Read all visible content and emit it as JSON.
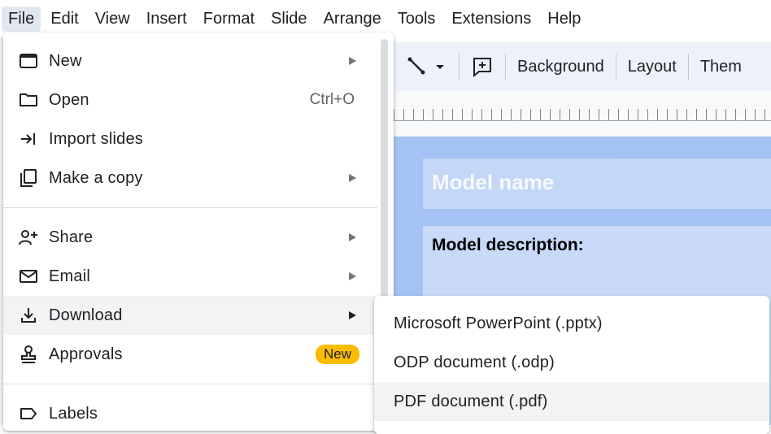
{
  "menubar": {
    "items": [
      "File",
      "Edit",
      "View",
      "Insert",
      "Format",
      "Slide",
      "Arrange",
      "Tools",
      "Extensions",
      "Help"
    ]
  },
  "toolbar": {
    "background_label": "Background",
    "layout_label": "Layout",
    "theme_label": "Them"
  },
  "slide": {
    "title_placeholder": "Model name",
    "description_label": "Model description:"
  },
  "file_menu": {
    "items": [
      {
        "label": "New",
        "icon": "new-presentation-icon",
        "submenu": true
      },
      {
        "label": "Open",
        "icon": "folder-icon",
        "shortcut": "Ctrl+O"
      },
      {
        "label": "Import slides",
        "icon": "import-icon"
      },
      {
        "label": "Make a copy",
        "icon": "copy-icon",
        "submenu": true
      },
      {
        "label": "Share",
        "icon": "share-person-icon",
        "submenu": true
      },
      {
        "label": "Email",
        "icon": "email-icon",
        "submenu": true
      },
      {
        "label": "Download",
        "icon": "download-icon",
        "submenu": true
      },
      {
        "label": "Approvals",
        "icon": "approvals-stamp-icon",
        "badge": "New"
      },
      {
        "label": "Labels",
        "icon": "label-icon"
      }
    ]
  },
  "download_submenu": {
    "items": [
      {
        "label": "Microsoft PowerPoint (.pptx)"
      },
      {
        "label": "ODP document (.odp)"
      },
      {
        "label": "PDF document (.pdf)"
      }
    ]
  },
  "colors": {
    "badge": "#fbbc04",
    "slide_background": "#a4c2f4",
    "placeholder_box": "#c9daf8",
    "toolbar_background": "#edf2fa",
    "hover": "#f1f3f4"
  }
}
